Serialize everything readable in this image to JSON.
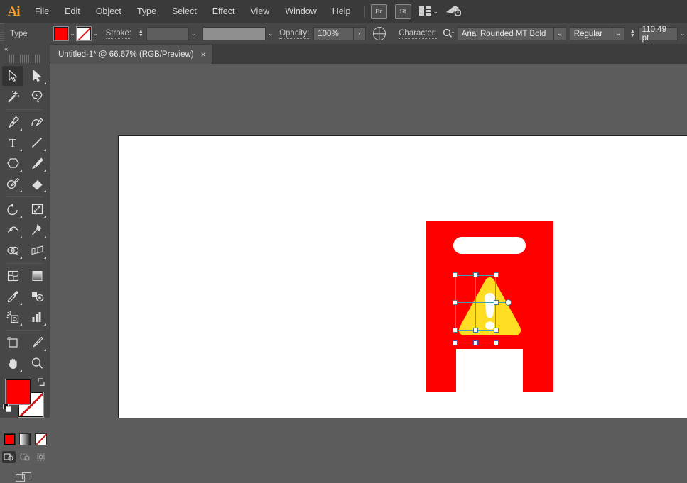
{
  "app": {
    "name": "Adobe Illustrator",
    "logo_text": "Ai"
  },
  "menubar": {
    "items": [
      {
        "label": "File"
      },
      {
        "label": "Edit"
      },
      {
        "label": "Object"
      },
      {
        "label": "Type"
      },
      {
        "label": "Select"
      },
      {
        "label": "Effect"
      },
      {
        "label": "View"
      },
      {
        "label": "Window"
      },
      {
        "label": "Help"
      }
    ],
    "bridge_badge": "Br",
    "stock_badge": "St",
    "arrange_chevron": "⌄"
  },
  "controlbar": {
    "context_label": "Type",
    "fill_color": "#ff0000",
    "stroke_label": "Stroke:",
    "stroke_value": "",
    "stroke_style_value": "",
    "opacity_label": "Opacity:",
    "opacity_value": "100%",
    "opacity_more": "›",
    "character_label": "Character:",
    "font_family": "Arial Rounded MT Bold",
    "font_style": "Regular",
    "font_size": "110.49 pt",
    "chevron": "⌄"
  },
  "tabbar": {
    "document_title": "Untitled-1* @ 66.67% (RGB/Preview)",
    "close_glyph": "×"
  },
  "toolpanel": {
    "collapse_glyph": "«",
    "tools": [
      {
        "name": "selection-tool",
        "label": "Selection",
        "active": true,
        "has_flyout": false
      },
      {
        "name": "direct-selection-tool",
        "label": "Direct Selection",
        "active": false,
        "has_flyout": true
      },
      {
        "name": "magic-wand-tool",
        "label": "Magic Wand",
        "active": false,
        "has_flyout": false
      },
      {
        "name": "lasso-tool",
        "label": "Lasso",
        "active": false,
        "has_flyout": false
      },
      {
        "name": "pen-tool",
        "label": "Pen",
        "active": false,
        "has_flyout": true
      },
      {
        "name": "curvature-tool",
        "label": "Curvature",
        "active": false,
        "has_flyout": false
      },
      {
        "name": "type-tool",
        "label": "Type",
        "active": false,
        "has_flyout": true
      },
      {
        "name": "line-segment-tool",
        "label": "Line Segment",
        "active": false,
        "has_flyout": true
      },
      {
        "name": "shape-tool",
        "label": "Rectangle",
        "active": false,
        "has_flyout": true
      },
      {
        "name": "paintbrush-tool",
        "label": "Paintbrush",
        "active": false,
        "has_flyout": true
      },
      {
        "name": "shaper-tool",
        "label": "Shaper",
        "active": false,
        "has_flyout": true
      },
      {
        "name": "eraser-tool",
        "label": "Eraser",
        "active": false,
        "has_flyout": true
      },
      {
        "name": "rotate-tool",
        "label": "Rotate",
        "active": false,
        "has_flyout": true
      },
      {
        "name": "scale-tool",
        "label": "Scale",
        "active": false,
        "has_flyout": true
      },
      {
        "name": "width-tool",
        "label": "Width",
        "active": false,
        "has_flyout": true
      },
      {
        "name": "free-transform-tool",
        "label": "Free Transform",
        "active": false,
        "has_flyout": true
      },
      {
        "name": "shape-builder-tool",
        "label": "Shape Builder",
        "active": false,
        "has_flyout": true
      },
      {
        "name": "perspective-grid-tool",
        "label": "Perspective Grid",
        "active": false,
        "has_flyout": true
      },
      {
        "name": "mesh-tool",
        "label": "Mesh",
        "active": false,
        "has_flyout": false
      },
      {
        "name": "gradient-tool",
        "label": "Gradient",
        "active": false,
        "has_flyout": false
      },
      {
        "name": "eyedropper-tool",
        "label": "Eyedropper",
        "active": false,
        "has_flyout": true
      },
      {
        "name": "blend-tool",
        "label": "Blend",
        "active": false,
        "has_flyout": false
      },
      {
        "name": "symbol-sprayer-tool",
        "label": "Symbol Sprayer",
        "active": false,
        "has_flyout": true
      },
      {
        "name": "column-graph-tool",
        "label": "Column Graph",
        "active": false,
        "has_flyout": true
      },
      {
        "name": "artboard-tool",
        "label": "Artboard",
        "active": false,
        "has_flyout": false
      },
      {
        "name": "slice-tool",
        "label": "Slice",
        "active": false,
        "has_flyout": true
      },
      {
        "name": "hand-tool",
        "label": "Hand",
        "active": false,
        "has_flyout": true
      },
      {
        "name": "zoom-tool",
        "label": "Zoom",
        "active": false,
        "has_flyout": false
      }
    ],
    "fill_color": "#ff0000",
    "stroke_color": "none",
    "color_modes": [
      {
        "name": "color-mode-button",
        "label": "Color"
      },
      {
        "name": "gradient-mode-button",
        "label": "Gradient"
      },
      {
        "name": "none-mode-button",
        "label": "None"
      }
    ],
    "draw_modes": [
      {
        "name": "draw-normal-button",
        "label": "Draw Normal",
        "active": true
      },
      {
        "name": "draw-behind-button",
        "label": "Draw Behind",
        "active": false
      },
      {
        "name": "draw-inside-button",
        "label": "Draw Inside",
        "active": false
      }
    ],
    "screen_mode_label": "Change Screen Mode"
  },
  "artwork": {
    "description": "Red warning sign board with white handle slot and yellow warning triangle",
    "sign_color": "#ff0000",
    "handle_color": "#ffffff",
    "triangle_color": "#ffdd22",
    "selected_object": "warning-triangle",
    "selection_color": "#3f9fb0"
  }
}
